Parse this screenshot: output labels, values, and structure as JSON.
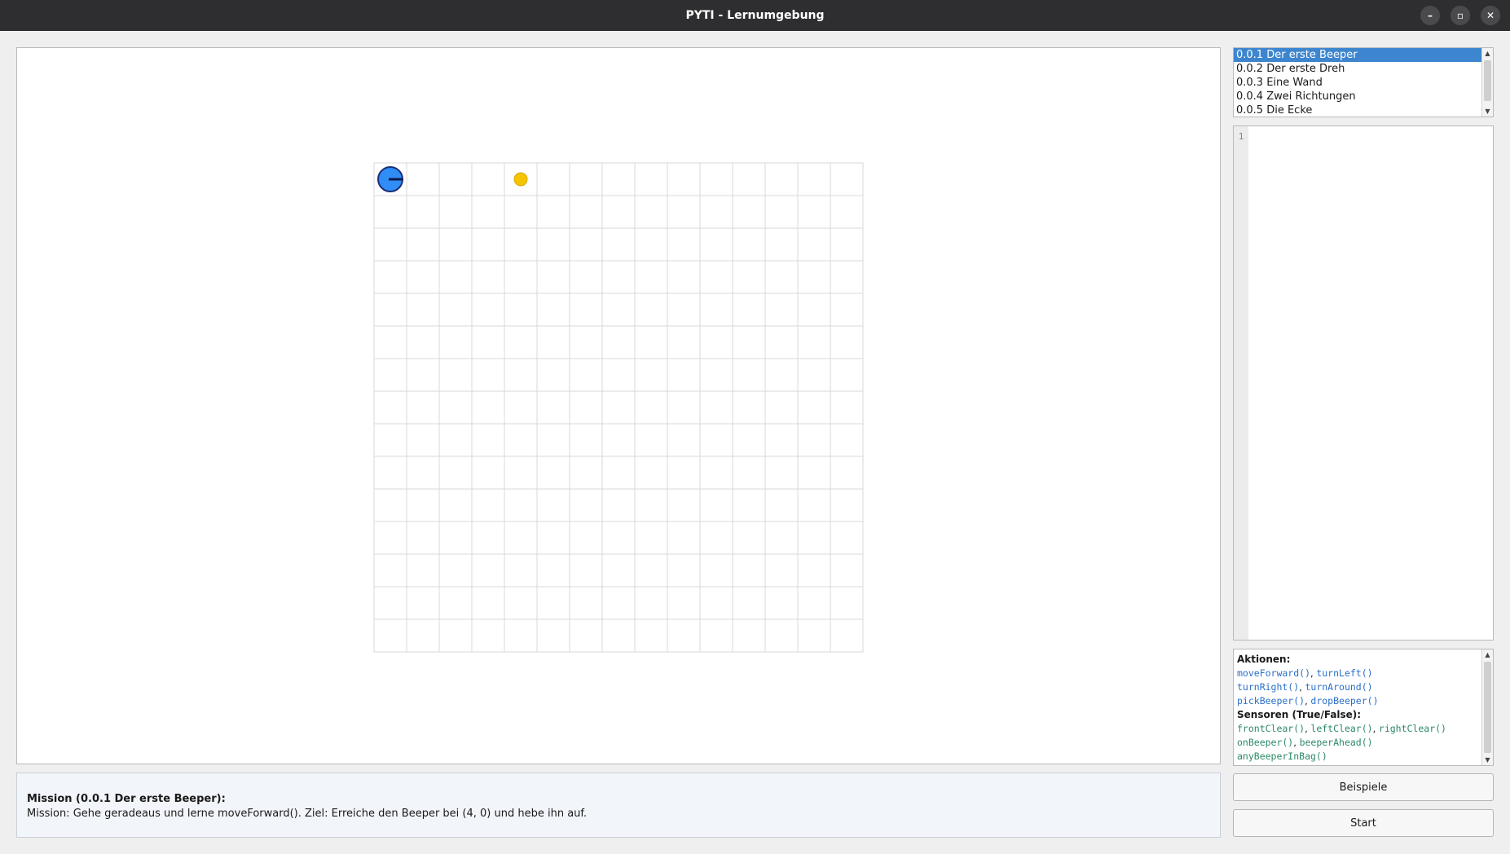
{
  "window": {
    "title": "PYTI - Lernumgebung",
    "minimize_glyph": "–",
    "maximize_glyph": "▫",
    "close_glyph": "✕"
  },
  "world": {
    "cols": 15,
    "rows": 15,
    "robot": {
      "x": 0,
      "y": 0,
      "facing": "east"
    },
    "beepers": [
      {
        "x": 4,
        "y": 0
      }
    ],
    "colors": {
      "grid": "#d8d8d8",
      "robot_fill": "#2f8df5",
      "robot_outline": "#1a2f7a",
      "beeper": "#f5c400"
    }
  },
  "levels": {
    "items": [
      "0.0.1 Der erste Beeper",
      "0.0.2 Der erste Dreh",
      "0.0.3 Eine Wand",
      "0.0.4 Zwei Richtungen",
      "0.0.5 Die Ecke"
    ],
    "selected_index": 0
  },
  "editor": {
    "line_number": "1",
    "code": ""
  },
  "help": {
    "actions_heading": "Aktionen:",
    "action_lines": [
      [
        "moveForward()",
        "turnLeft()"
      ],
      [
        "turnRight()",
        "turnAround()"
      ],
      [
        "pickBeeper()",
        "dropBeeper()"
      ]
    ],
    "sensors_heading": "Sensoren (True/False):",
    "sensor_lines": [
      [
        "frontClear()",
        "leftClear()",
        "rightClear()"
      ],
      [
        "onBeeper()",
        "beeperAhead()"
      ],
      [
        "anyBeeperInBag()"
      ]
    ]
  },
  "mission": {
    "heading": "Mission (0.0.1 Der erste Beeper):",
    "text": "Mission: Gehe geradeaus und lerne moveForward(). Ziel: Erreiche den Beeper bei (4, 0) und hebe ihn auf."
  },
  "buttons": {
    "examples": "Beispiele",
    "start": "Start"
  },
  "icons": {
    "scroll_up": "▲",
    "scroll_down": "▼"
  }
}
